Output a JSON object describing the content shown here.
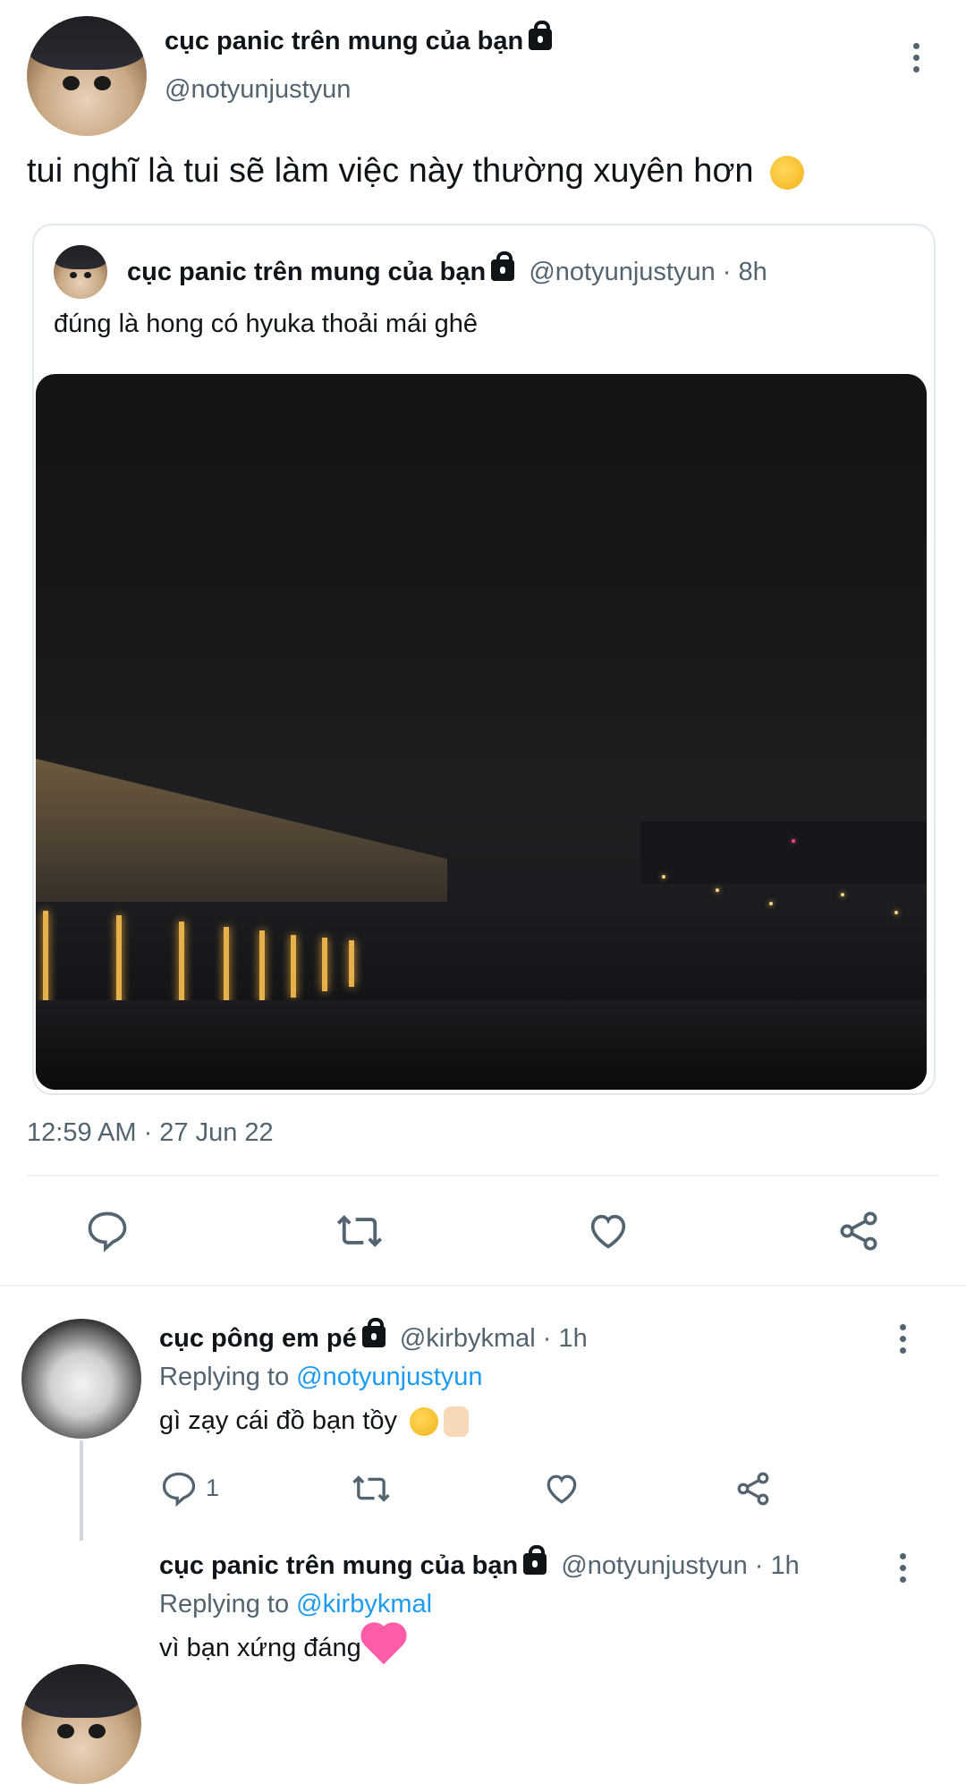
{
  "main_tweet": {
    "display_name": "cục panic trên mung của bạn",
    "handle": "@notyunjustyun",
    "text": "tui nghĩ là tui sẽ làm việc này thường xuyên hơn",
    "timestamp": "12:59 AM · 27 Jun 22"
  },
  "quoted_tweet": {
    "display_name": "cục panic trên mung của bạn",
    "handle": "@notyunjustyun",
    "age": "· 8h",
    "text": "đúng là hong có hyuka thoải mái ghê"
  },
  "replies": [
    {
      "display_name": "cục pông em pé",
      "handle": "@kirbykmal",
      "age": "· 1h",
      "replying_prefix": "Replying to",
      "replying_to": "@notyunjustyun",
      "text": "gì zạy cái đồ bạn tồy",
      "reply_count": "1"
    },
    {
      "display_name": "cục panic trên mung của bạn",
      "handle": "@notyunjustyun",
      "age": "· 1h",
      "replying_prefix": "Replying to",
      "replying_to": "@kirbykmal",
      "text": "vì bạn xứng đáng"
    }
  ],
  "icons": [
    "lock-icon",
    "more-icon",
    "reply-icon",
    "retweet-icon",
    "like-icon",
    "share-icon"
  ],
  "colors": {
    "link": "#1d9bf0",
    "muted": "#536471",
    "text": "#0f1419",
    "icon": "#536471"
  }
}
